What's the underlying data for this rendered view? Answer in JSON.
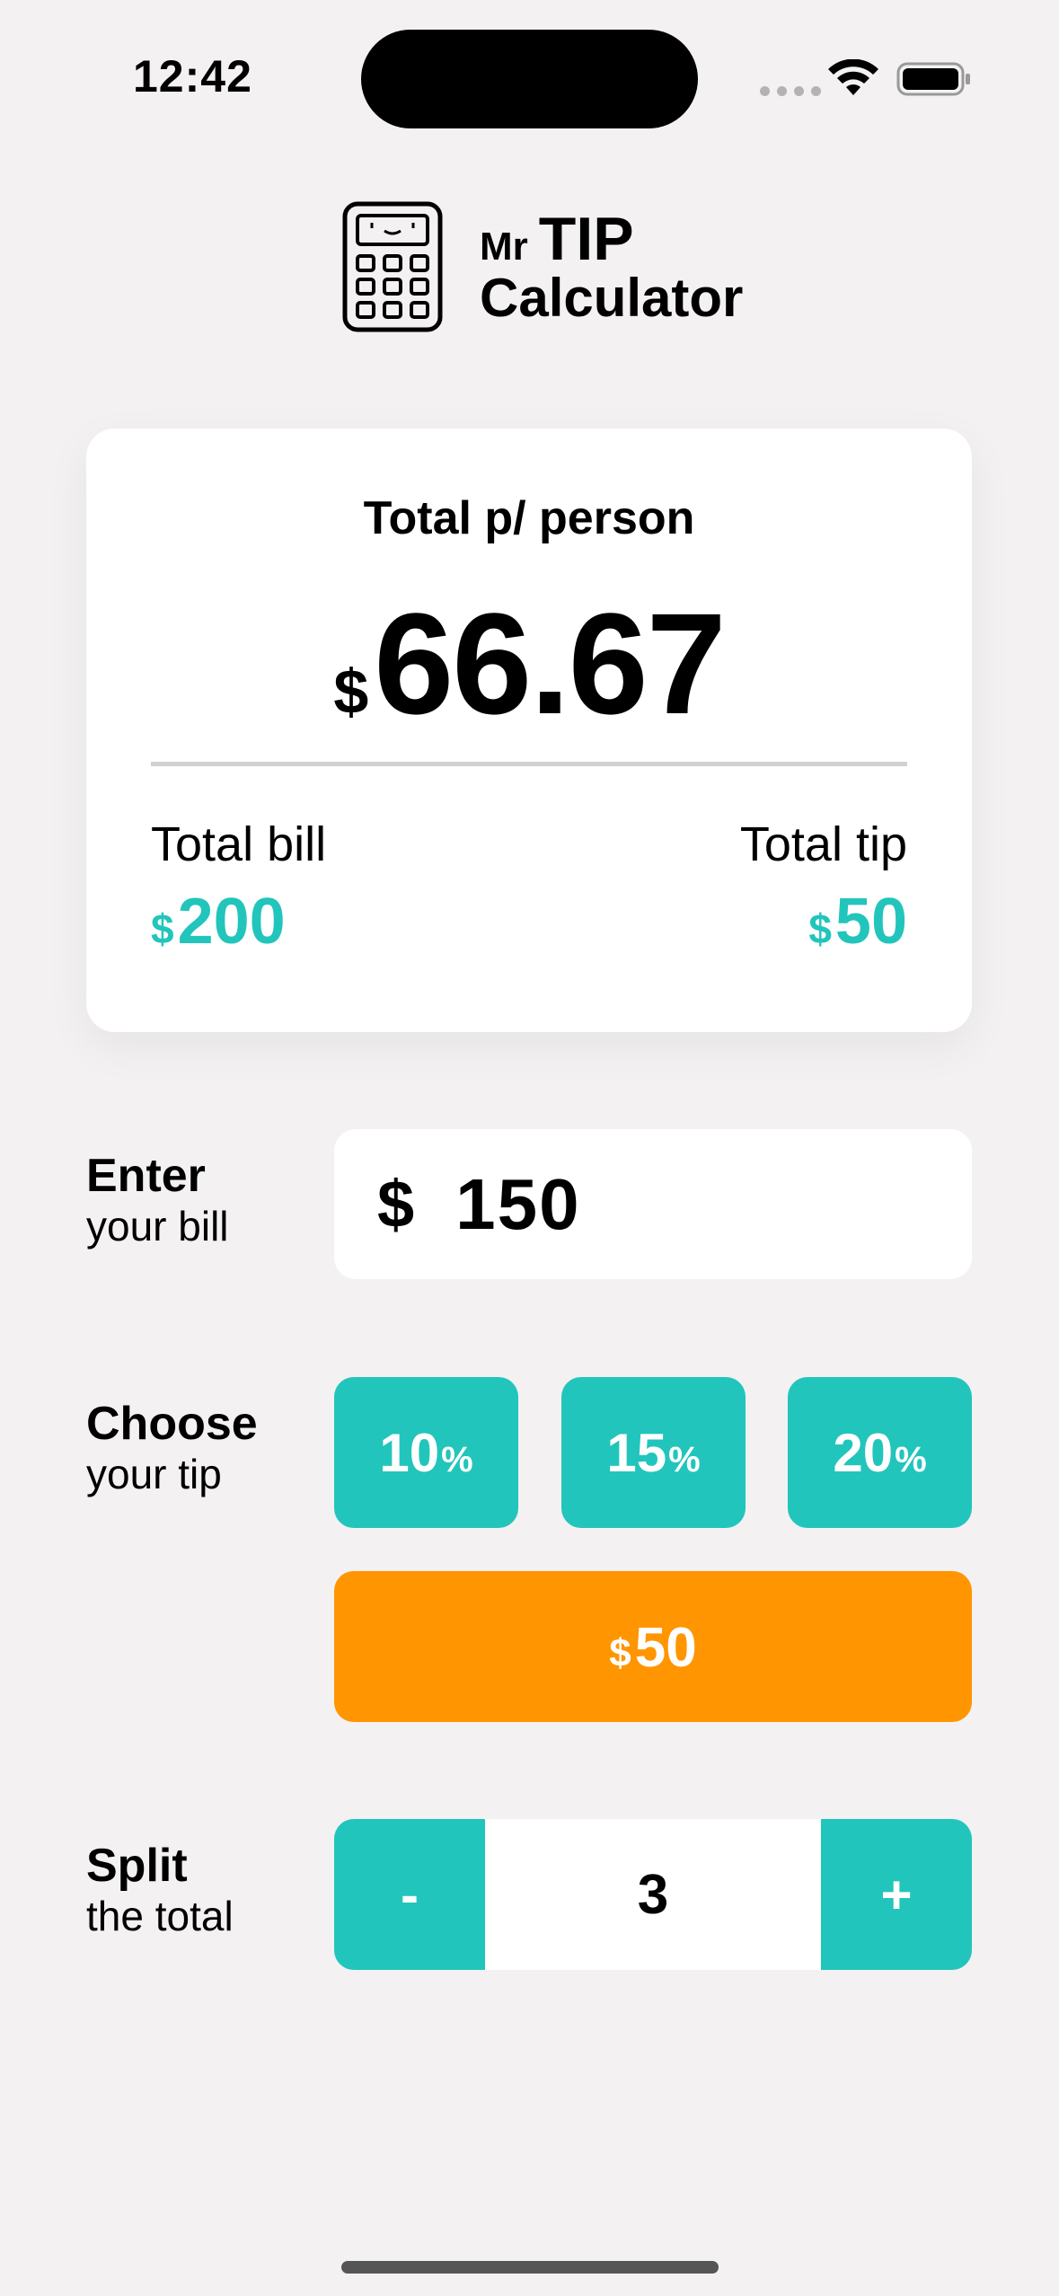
{
  "status_bar": {
    "time": "12:42",
    "icons": [
      "signal-dots-icon",
      "wifi-icon",
      "battery-icon"
    ]
  },
  "header": {
    "title_prefix": "Mr",
    "title_main": "TIP",
    "title_sub": "Calculator",
    "icon": "calculator-icon"
  },
  "summary": {
    "label": "Total p/ person",
    "currency": "$",
    "per_person": "66.67",
    "total_bill_label": "Total bill",
    "total_bill_currency": "$",
    "total_bill_value": "200",
    "total_tip_label": "Total tip",
    "total_tip_currency": "$",
    "total_tip_value": "50"
  },
  "bill": {
    "label_strong": "Enter",
    "label_light": "your bill",
    "currency": "$",
    "value": "150"
  },
  "tip": {
    "label_strong": "Choose",
    "label_light": "your tip",
    "options": [
      {
        "value": "10",
        "unit": "%"
      },
      {
        "value": "15",
        "unit": "%"
      },
      {
        "value": "20",
        "unit": "%"
      }
    ],
    "custom_currency": "$",
    "custom_value": "50"
  },
  "split": {
    "label_strong": "Split",
    "label_light": "the total",
    "minus": "-",
    "value": "3",
    "plus": "+"
  },
  "colors": {
    "accent": "#22c5bb",
    "orange": "#ff9500",
    "background": "#f3f1f2"
  }
}
